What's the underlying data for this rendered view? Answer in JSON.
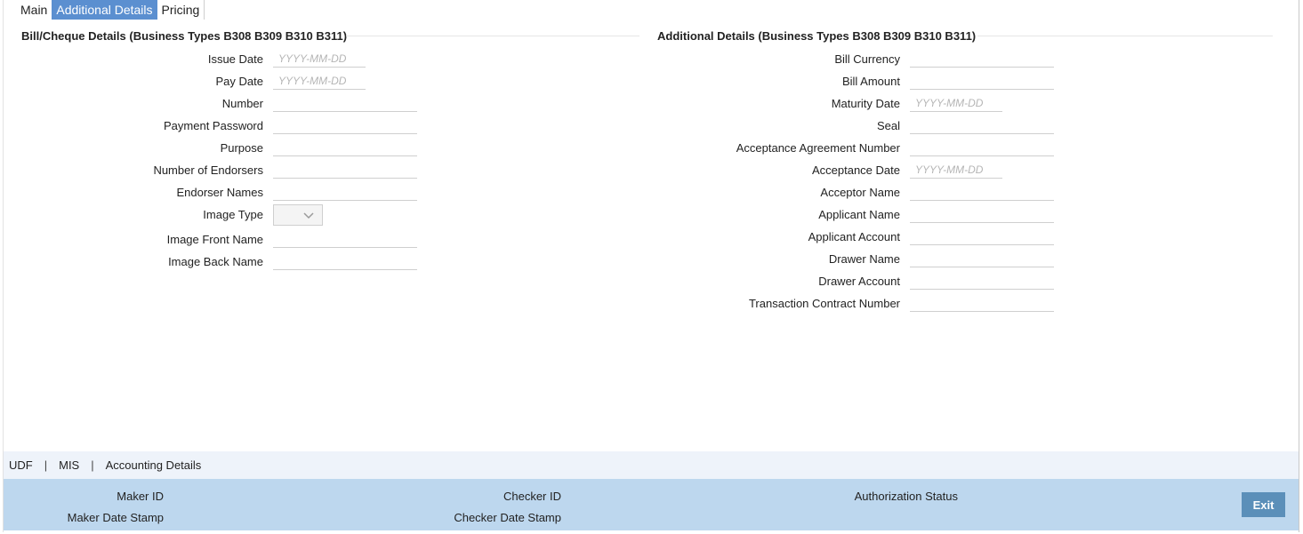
{
  "tabs": [
    {
      "label": "Main",
      "active": false
    },
    {
      "label": "Additional Details",
      "active": true
    },
    {
      "label": "Pricing",
      "active": false
    }
  ],
  "left_section": {
    "title": "Bill/Cheque Details (Business Types B308 B309 B310 B311)",
    "fields": {
      "issue_date": {
        "label": "Issue Date",
        "placeholder": "YYYY-MM-DD",
        "value": ""
      },
      "pay_date": {
        "label": "Pay Date",
        "placeholder": "YYYY-MM-DD",
        "value": ""
      },
      "number": {
        "label": "Number",
        "value": ""
      },
      "payment_password": {
        "label": "Payment Password",
        "value": ""
      },
      "purpose": {
        "label": "Purpose",
        "value": ""
      },
      "number_of_endorsers": {
        "label": "Number of Endorsers",
        "value": ""
      },
      "endorser_names": {
        "label": "Endorser Names",
        "value": ""
      },
      "image_type": {
        "label": "Image Type",
        "value": ""
      },
      "image_front_name": {
        "label": "Image Front Name",
        "value": ""
      },
      "image_back_name": {
        "label": "Image Back Name",
        "value": ""
      }
    }
  },
  "right_section": {
    "title": "Additional Details (Business Types B308 B309 B310 B311)",
    "fields": {
      "bill_currency": {
        "label": "Bill Currency",
        "value": ""
      },
      "bill_amount": {
        "label": "Bill Amount",
        "value": ""
      },
      "maturity_date": {
        "label": "Maturity Date",
        "placeholder": "YYYY-MM-DD",
        "value": ""
      },
      "seal": {
        "label": "Seal",
        "value": ""
      },
      "acceptance_agreement_number": {
        "label": "Acceptance Agreement Number",
        "value": ""
      },
      "acceptance_date": {
        "label": "Acceptance Date",
        "placeholder": "YYYY-MM-DD",
        "value": ""
      },
      "acceptor_name": {
        "label": "Acceptor Name",
        "value": ""
      },
      "applicant_name": {
        "label": "Applicant Name",
        "value": ""
      },
      "applicant_account": {
        "label": "Applicant Account",
        "value": ""
      },
      "drawer_name": {
        "label": "Drawer Name",
        "value": ""
      },
      "drawer_account": {
        "label": "Drawer Account",
        "value": ""
      },
      "transaction_contract_number": {
        "label": "Transaction Contract Number",
        "value": ""
      }
    }
  },
  "links": {
    "udf": "UDF",
    "mis": "MIS",
    "accounting_details": "Accounting Details",
    "separator": "|"
  },
  "footer": {
    "maker_id": "Maker ID",
    "maker_date_stamp": "Maker Date Stamp",
    "checker_id": "Checker ID",
    "checker_date_stamp": "Checker Date Stamp",
    "authorization_status": "Authorization Status",
    "exit_label": "Exit"
  },
  "icons": {
    "select_chevron": "chevron-down-icon"
  },
  "colors": {
    "active_tab": "#5b8fd0",
    "footer_bg": "#bdd7ee",
    "linkbar_bg": "#eef3fa",
    "exit_button": "#5b8fb9"
  }
}
